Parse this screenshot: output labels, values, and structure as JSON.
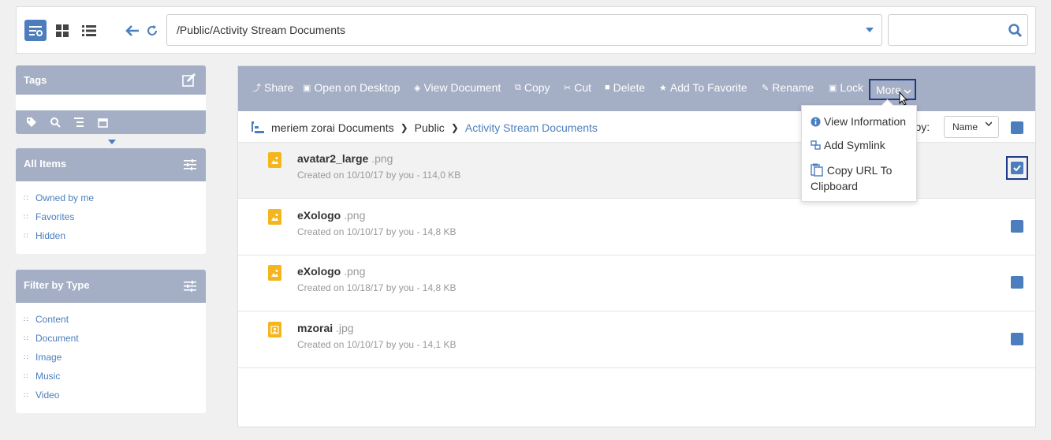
{
  "topbar": {
    "address": "/Public/Activity Stream Documents",
    "search_placeholder": ""
  },
  "tags_panel": {
    "title": "Tags"
  },
  "all_items_panel": {
    "title": "All Items",
    "items": [
      {
        "label": "Owned by me"
      },
      {
        "label": "Favorites"
      },
      {
        "label": "Hidden"
      }
    ]
  },
  "filter_panel": {
    "title": "Filter by Type",
    "items": [
      {
        "label": "Content"
      },
      {
        "label": "Document"
      },
      {
        "label": "Image"
      },
      {
        "label": "Music"
      },
      {
        "label": "Video"
      }
    ]
  },
  "actions": {
    "share": "Share",
    "open_desktop": "Open on Desktop",
    "view_document": "View Document",
    "copy": "Copy",
    "cut": "Cut",
    "delete": "Delete",
    "favorite": "Add To Favorite",
    "rename": "Rename",
    "lock": "Lock",
    "more": "More"
  },
  "breadcrumb": {
    "root": "meriem zorai Documents",
    "level1": "Public",
    "current": "Activity Stream Documents"
  },
  "sort": {
    "label": "rt by:",
    "value": "Name"
  },
  "files": [
    {
      "name": "avatar2_large",
      "ext": ".png",
      "meta": "Created on 10/10/17 by you - 114,0 KB",
      "selected": true
    },
    {
      "name": "eXologo",
      "ext": ".png",
      "meta": "Created on 10/10/17 by you - 14,8 KB"
    },
    {
      "name": "eXologo",
      "ext": ".png",
      "meta": "Created on 10/18/17 by you - 14,8 KB"
    },
    {
      "name": "mzorai",
      "ext": ".jpg",
      "meta": "Created on 10/10/17 by you - 14,1 KB"
    }
  ],
  "dropdown": {
    "view_info": "View Information",
    "add_symlink": "Add Symlink",
    "copy_url_1": "Copy URL To",
    "copy_url_2": "Clipboard"
  },
  "colors": {
    "accent": "#4c7ebd",
    "header": "#a4aec4",
    "file_icon": "#f5b51c"
  }
}
